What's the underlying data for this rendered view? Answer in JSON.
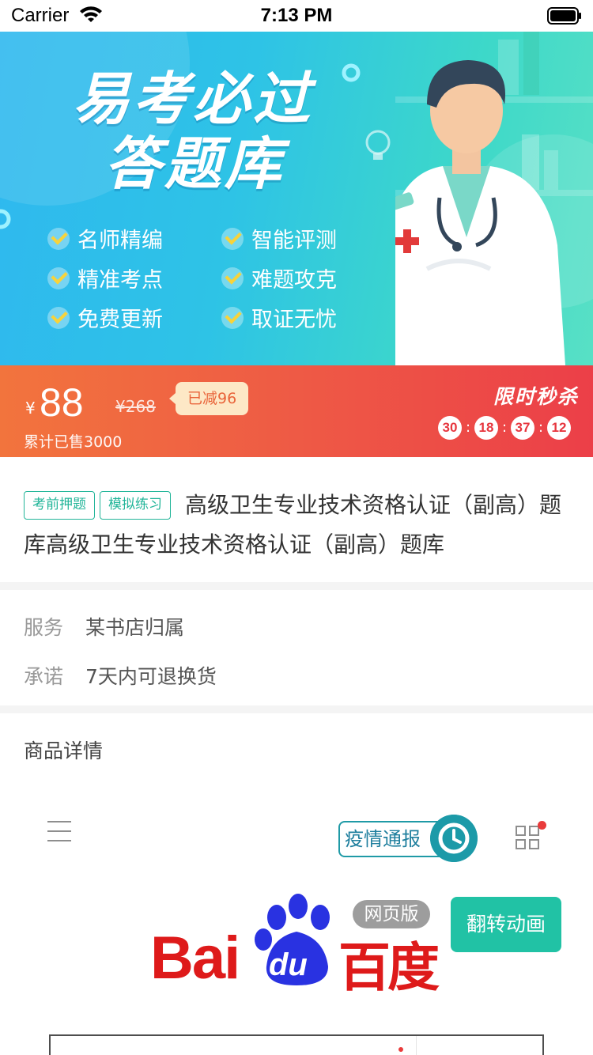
{
  "status_bar": {
    "carrier": "Carrier",
    "time": "7:13 PM"
  },
  "banner": {
    "title_line1": "易考必过",
    "title_line2": "答题库",
    "features": [
      "名师精编",
      "智能评测",
      "精准考点",
      "难题攻克",
      "免费更新",
      "取证无忧"
    ]
  },
  "price": {
    "currency": "¥",
    "current": "88",
    "original": "¥268",
    "discount": "已减96",
    "sold": "累计已售3000",
    "flash_sale_label": "限时秒杀",
    "countdown": [
      "30",
      "18",
      "37",
      "12"
    ],
    "countdown_sep": ":"
  },
  "product": {
    "tags": [
      "考前押题",
      "模拟练习"
    ],
    "title": "高级卫生专业技术资格认证（副高）题库高级卫生专业技术资格认证（副高）题库"
  },
  "service": {
    "service_label": "服务",
    "service_value": "某书店归属",
    "promise_label": "承诺",
    "promise_value": "7天内可退换货"
  },
  "details": {
    "title": "商品详情",
    "embedded": {
      "epidemic_label": "疫情通报",
      "logo_text_latin": "Bai",
      "logo_text_du": "du",
      "logo_text_cn": "百度",
      "web_badge": "网页版",
      "flip_button": "翻转动画"
    }
  },
  "colors": {
    "accent_green": "#22b599",
    "price_red": "#ec3f48",
    "baidu_red": "#de1a1a",
    "baidu_blue": "#2932e1"
  }
}
